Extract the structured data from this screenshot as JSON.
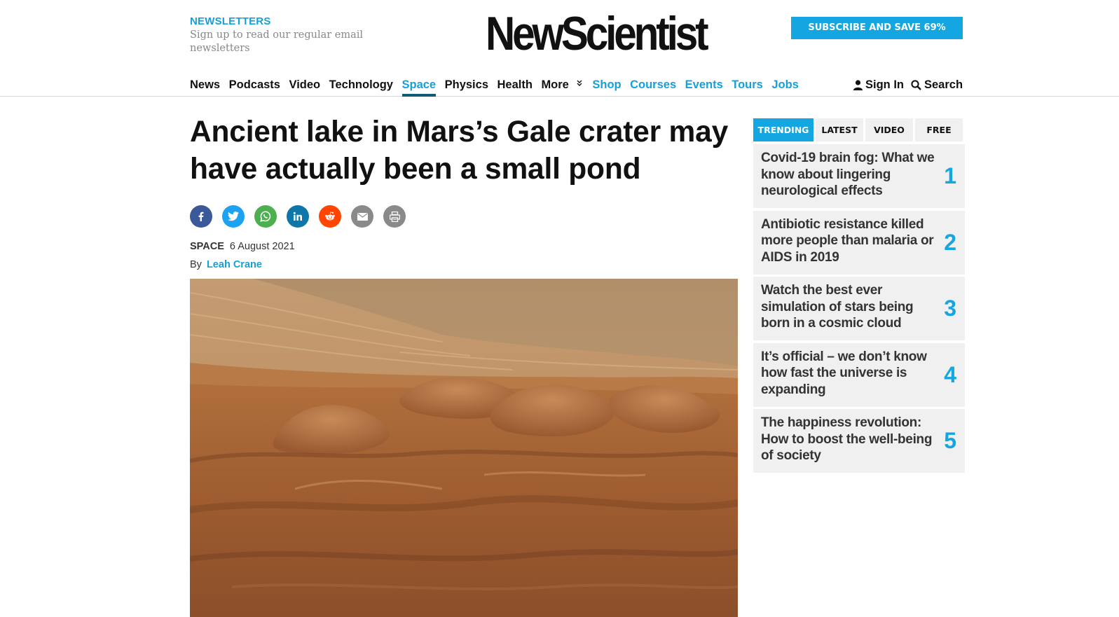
{
  "newsletters": {
    "title": "NEWSLETTERS",
    "text": "Sign up to read our regular email newsletters"
  },
  "logo": "NewScientist",
  "subscribe_label": "SUBSCRIBE AND SAVE 69%",
  "nav": {
    "items": [
      {
        "label": "News"
      },
      {
        "label": "Podcasts"
      },
      {
        "label": "Video"
      },
      {
        "label": "Technology"
      },
      {
        "label": "Space"
      },
      {
        "label": "Physics"
      },
      {
        "label": "Health"
      },
      {
        "label": "More"
      },
      {
        "label": "Shop"
      },
      {
        "label": "Courses"
      },
      {
        "label": "Events"
      },
      {
        "label": "Tours"
      },
      {
        "label": "Jobs"
      }
    ],
    "active": "Space",
    "sign_in": "Sign In",
    "search": "Search"
  },
  "article": {
    "headline": "Ancient lake in Mars’s Gale crater may have actually been a small pond",
    "section": "SPACE",
    "date": "6 August 2021",
    "by": "By",
    "author": "Leah Crane"
  },
  "share": [
    {
      "name": "facebook-icon",
      "color": "#3b5998"
    },
    {
      "name": "twitter-icon",
      "color": "#1da1f2"
    },
    {
      "name": "whatsapp-icon",
      "color": "#4caf50"
    },
    {
      "name": "linkedin-icon",
      "color": "#0e76a8"
    },
    {
      "name": "reddit-icon",
      "color": "#ff4500"
    },
    {
      "name": "email-icon",
      "color": "#8a8a8a"
    },
    {
      "name": "print-icon",
      "color": "#8a8a8a"
    }
  ],
  "sidebar": {
    "tabs": [
      {
        "label": "TRENDING"
      },
      {
        "label": "LATEST"
      },
      {
        "label": "VIDEO"
      },
      {
        "label": "FREE"
      }
    ],
    "active_tab": "TRENDING",
    "items": [
      {
        "title": "Covid-19 brain fog: What we know about lingering neurological effects",
        "num": "1"
      },
      {
        "title": "Antibiotic resistance killed more people than malaria or AIDS in 2019",
        "num": "2"
      },
      {
        "title": "Watch the best ever simulation of stars being born in a cosmic cloud",
        "num": "3"
      },
      {
        "title": "It’s official – we don’t know how fast the universe is expanding",
        "num": "4"
      },
      {
        "title": "The happiness revolution: How to boost the well-being of society",
        "num": "5"
      }
    ]
  },
  "colors": {
    "accent": "#14a6e0",
    "active_underline": "#0f5b78",
    "sidebar_bg": "#f0f0f0"
  }
}
